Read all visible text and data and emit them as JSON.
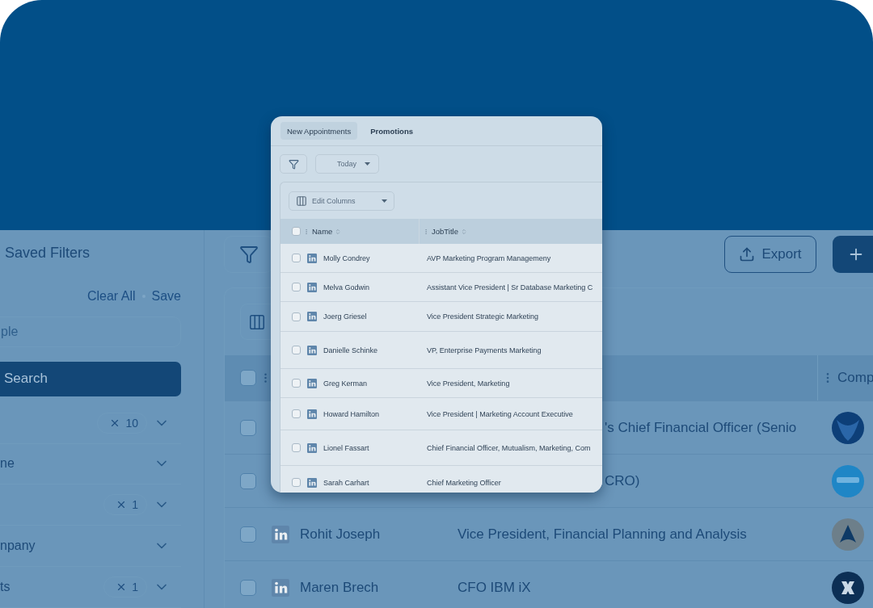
{
  "sidebar": {
    "title": "Saved Filters",
    "clear": "Clear All",
    "save": "Save",
    "search_placeholder": "ple",
    "search_button": "Search",
    "filters": [
      {
        "count": "10"
      },
      {
        "label": "ne"
      },
      {
        "count": "1"
      },
      {
        "label": "npany"
      },
      {
        "label": "ts",
        "count": "1"
      }
    ]
  },
  "main": {
    "export": "Export",
    "company_column": "Comp",
    "all_checked": false,
    "rows": [
      {
        "kind": "covered",
        "title": "'s Chief Financial Officer (Senio",
        "checked": false
      },
      {
        "kind": "covered",
        "title": "CRO)",
        "checked": false
      },
      {
        "kind": "full",
        "name": "Rohit Joseph",
        "title": "Vice President, Financial Planning and Analysis",
        "checked": false
      },
      {
        "kind": "full",
        "name": "Maren Brech",
        "title": "CFO IBM iX",
        "checked": false
      }
    ]
  },
  "card": {
    "tabs": [
      {
        "label": "New Appointments",
        "selected": true
      },
      {
        "label": "Promotions",
        "selected": false
      }
    ],
    "date_filter": "Today",
    "edit_columns": "Edit Columns",
    "columns": [
      "Name",
      "JobTitle"
    ],
    "all_checked": false,
    "rows": [
      {
        "name": "Molly Condrey",
        "title": "AVP Marketing Program Managemeny",
        "checked": false
      },
      {
        "name": "Melva Godwin",
        "title": "Assistant Vice President | Sr Database Marketing C",
        "checked": false
      },
      {
        "name": "Joerg Griesel",
        "title": "Vice President Strategic Marketing",
        "checked": false
      },
      {
        "name": "Danielle Schinke",
        "title": "VP, Enterprise Payments Marketing",
        "checked": false
      },
      {
        "name": "Greg Kerman",
        "title": "Vice President, Marketing",
        "checked": false
      },
      {
        "name": "Howard Hamilton",
        "title": "Vice President | Marketing Account Executive",
        "checked": false
      },
      {
        "name": "Lionel Fassart",
        "title": "Chief Financial Officer, Mutualism, Marketing, Com",
        "checked": false
      },
      {
        "name": "Sarah Carhart",
        "title": "Chief Marketing Officer",
        "checked": false
      }
    ]
  }
}
